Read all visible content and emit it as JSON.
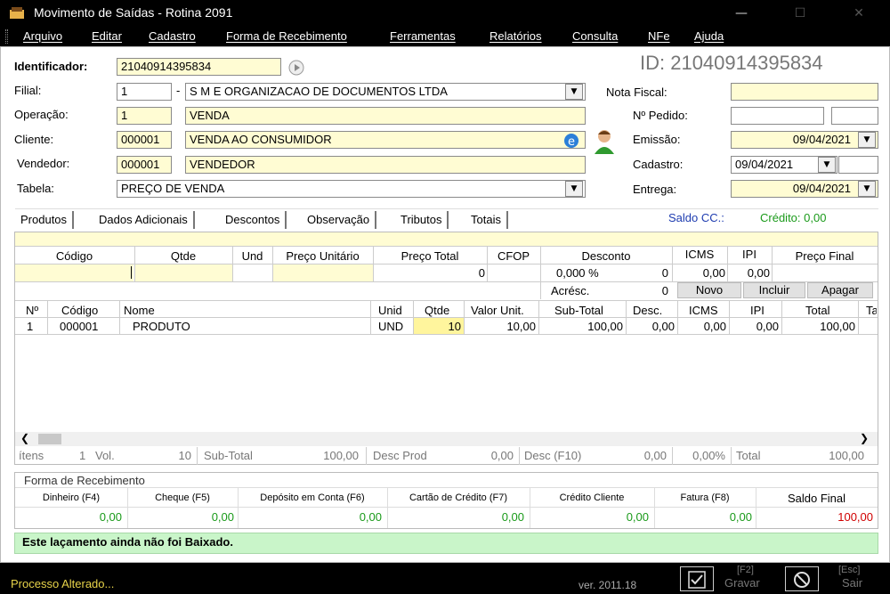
{
  "window": {
    "title": "Movimento de Saídas - Rotina 2091",
    "min": "—",
    "max": "☐",
    "close": "✕"
  },
  "menu": [
    "Arquivo",
    "Editar",
    "Cadastro",
    "Forma de Recebimento",
    "Ferramentas",
    "Relatórios",
    "Consulta",
    "NFe",
    "Ajuda"
  ],
  "form": {
    "identificador_label": "Identificador:",
    "identificador_value": "21040914395834",
    "id_display": "ID: 21040914395834",
    "filial_label": "Filial:",
    "filial_code": "1",
    "filial_sep": "-",
    "filial_name": "S M E ORGANIZACAO DE DOCUMENTOS LTDA",
    "operacao_label": "Operação:",
    "operacao_code": "1",
    "operacao_name": "VENDA",
    "cliente_label": "Cliente:",
    "cliente_code": "000001",
    "cliente_name": "VENDA AO CONSUMIDOR",
    "vendedor_label": "Vendedor:",
    "vendedor_code": "000001",
    "vendedor_name": "VENDEDOR",
    "tabela_label": "Tabela:",
    "tabela_value": "PREÇO DE VENDA",
    "nota_fiscal_label": "Nota Fiscal:",
    "nota_fiscal_value": "",
    "pedido_label": "Nº Pedido:",
    "pedido_value": "",
    "pedido_value2": "",
    "emissao_label": "Emissão:",
    "emissao_value": "09/04/2021",
    "cadastro_label": "Cadastro:",
    "cadastro_value": "09/04/2021",
    "cadastro_time": "",
    "entrega_label": "Entrega:",
    "entrega_value": "09/04/2021"
  },
  "tabs": [
    "Produtos",
    "Dados Adicionais",
    "Descontos",
    "Observação",
    "Tributos",
    "Totais"
  ],
  "saldo_cc": "Saldo CC.:",
  "credito": "Crédito: 0,00",
  "entry": {
    "headers": [
      "Código",
      "Qtde",
      "Und",
      "Preço Unitário",
      "Preço Total",
      "CFOP",
      "Desconto",
      "ICMS",
      "IPI",
      "Preço Final"
    ],
    "preco_total": "0",
    "desconto_pct": "0,000 %",
    "desconto_val": "0",
    "icms": "0,00",
    "ipi": "0,00",
    "acresc_label": "Acrésc.",
    "acresc_val": "0",
    "btn_novo": "Novo",
    "btn_incluir": "Incluir",
    "btn_apagar": "Apagar"
  },
  "items": {
    "headers": [
      "Nº",
      "Código",
      "Nome",
      "Unid",
      "Qtde",
      "Valor Unit.",
      "Sub-Total",
      "Desc.",
      "ICMS",
      "IPI",
      "Total",
      "Ta"
    ],
    "rows": [
      [
        "1",
        "000001",
        "PRODUTO",
        "UND",
        "10",
        "10,00",
        "100,00",
        "0,00",
        "0,00",
        "0,00",
        "100,00"
      ]
    ]
  },
  "summary": {
    "itens_label": "ítens",
    "itens": "1",
    "vol_label": "Vol.",
    "vol": "10",
    "subtotal_label": "Sub-Total",
    "subtotal": "100,00",
    "descprod_label": "Desc Prod",
    "descprod": "0,00",
    "descf10_label": "Desc (F10)",
    "descf10": "0,00",
    "pct": "0,00%",
    "total_label": "Total",
    "total": "100,00"
  },
  "recebimento": {
    "title": "Forma de Recebimento",
    "cols": [
      "Dinheiro (F4)",
      "Cheque (F5)",
      "Depósito em Conta (F6)",
      "Cartão de Crédito (F7)",
      "Crédito Cliente",
      "Fatura (F8)",
      "Saldo Final"
    ],
    "values": [
      "0,00",
      "0,00",
      "0,00",
      "0,00",
      "0,00",
      "0,00",
      "100,00"
    ]
  },
  "status_message": "Este laçamento ainda não foi Baixado.",
  "bottom": {
    "status": "Processo Alterado...",
    "version": "ver. 2011.18",
    "gravar_key": "[F2]",
    "gravar": "Gravar",
    "sair_key": "[Esc]",
    "sair": "Sair"
  },
  "colors": {
    "field_yellow": "#fffcd3",
    "status_green": "#c9f5c9",
    "credit_green": "#1a9a1a",
    "saldo_blue": "#1e3cb0",
    "saldo_red": "#d00000"
  }
}
